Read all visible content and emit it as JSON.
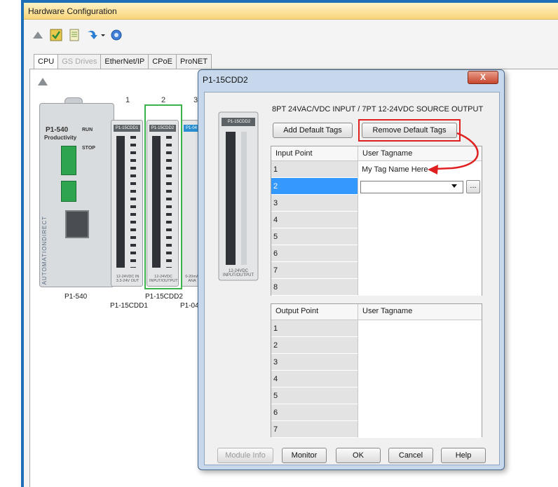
{
  "window": {
    "title": "Hardware Configuration"
  },
  "toolbar": {
    "icons": [
      "upload-icon",
      "checkmark-icon",
      "notepad-icon",
      "arrow-dropdown-icon",
      "help-icon"
    ]
  },
  "tabs": [
    {
      "label": "CPU",
      "state": "active"
    },
    {
      "label": "GS Drives",
      "state": "disabled"
    },
    {
      "label": "EtherNet/IP",
      "state": "normal"
    },
    {
      "label": "CPoE",
      "state": "normal"
    },
    {
      "label": "ProNET",
      "state": "normal"
    }
  ],
  "rack": {
    "slot_numbers": [
      "1",
      "2",
      "3"
    ],
    "cpu": {
      "model_text": "P1-540",
      "brand_text": "Productivity",
      "run_text": "RUN",
      "stop_text": "STOP",
      "brand_vertical": "AUTOMATIONDIRECT",
      "caption": "P1-540"
    },
    "modules": [
      {
        "header": "P1-15CDD1",
        "footer": "12-24VDC IN 3.3-24V OUT",
        "caption": "P1-15CDD1"
      },
      {
        "header": "P1-15CDD2",
        "footer": "12-24VDC INPUT/OUTPUT",
        "caption": "P1-15CDD2"
      },
      {
        "header": "P1-04",
        "footer": "0-20mA ANA",
        "caption": "P1-04/"
      }
    ]
  },
  "dialog": {
    "title": "P1-15CDD2",
    "close_label": "X",
    "module_picture_header": "P1-15CDD2",
    "module_picture_footer": "12-24VDC INPUT/OUTPUT",
    "description": "8PT 24VAC/VDC INPUT / 7PT 12-24VDC SOURCE OUTPUT",
    "add_default_tags_label": "Add Default Tags",
    "remove_default_tags_label": "Remove Default Tags",
    "input_grid": {
      "col1": "Input Point",
      "col2": "User Tagname",
      "rows": [
        {
          "point": "1",
          "tag": "My Tag Name Here"
        },
        {
          "point": "2",
          "tag": ""
        },
        {
          "point": "3",
          "tag": ""
        },
        {
          "point": "4",
          "tag": ""
        },
        {
          "point": "5",
          "tag": ""
        },
        {
          "point": "6",
          "tag": ""
        },
        {
          "point": "7",
          "tag": ""
        },
        {
          "point": "8",
          "tag": ""
        }
      ],
      "selected_row": "2",
      "edit_value": "",
      "ellipsis_label": "..."
    },
    "output_grid": {
      "col1": "Output Point",
      "col2": "User Tagname",
      "rows": [
        {
          "point": "1",
          "tag": ""
        },
        {
          "point": "2",
          "tag": ""
        },
        {
          "point": "3",
          "tag": ""
        },
        {
          "point": "4",
          "tag": ""
        },
        {
          "point": "5",
          "tag": ""
        },
        {
          "point": "6",
          "tag": ""
        },
        {
          "point": "7",
          "tag": ""
        }
      ]
    },
    "buttons": {
      "module_info": "Module Info",
      "monitor": "Monitor",
      "ok": "OK",
      "cancel": "Cancel",
      "help": "Help"
    }
  },
  "colors": {
    "frame": "#1f6fb6",
    "selection_green": "#3cb34a",
    "callout_red": "#e02020",
    "row_selected": "#3399ff"
  }
}
